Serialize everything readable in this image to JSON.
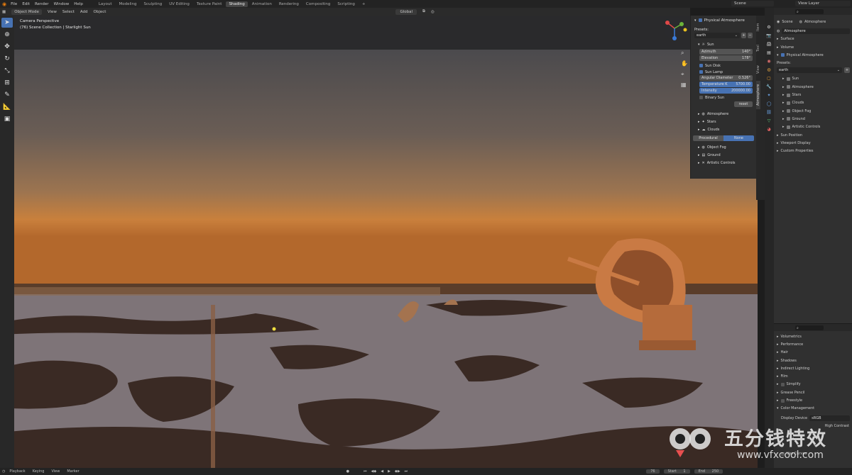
{
  "menu": [
    "File",
    "Edit",
    "Render",
    "Window",
    "Help"
  ],
  "workspaces": [
    "Layout",
    "Modeling",
    "Sculpting",
    "UV Editing",
    "Texture Paint",
    "Shading",
    "Animation",
    "Rendering",
    "Compositing",
    "Scripting",
    "+"
  ],
  "active_workspace_index": 5,
  "scene_field": "Scene",
  "view_layer_field": "View Layer",
  "viewport_header": {
    "mode": "Object Mode",
    "items": [
      "View",
      "Select",
      "Add",
      "Object"
    ],
    "transform": "Global"
  },
  "viewport_info": {
    "line1": "Camera Perspective",
    "line2": "(76) Scene Collection | Starlight Sun"
  },
  "npanel": {
    "addon_title": "Physical Atmosphere",
    "presets_label": "Presets:",
    "preset_value": "earth",
    "sun_header": "Sun",
    "azimuth_label": "Azimuth",
    "azimuth_value": "140°",
    "elevation_label": "Elevation",
    "elevation_value": "178°",
    "sun_disk": "Sun Disk",
    "sun_lamp": "Sun Lamp",
    "angular_label": "Angular Diameter",
    "angular_value": "0.526°",
    "temp_label": "Temperature K",
    "temp_value": "5700.00",
    "intensity_label": "Intensity",
    "intensity_value": "200000.00",
    "binary_sun": "Binary Sun",
    "reset": "reset",
    "atmosphere": "Atmosphere",
    "stars": "Stars",
    "clouds": "Clouds",
    "tab_procedural": "Procedural",
    "tab_none": "None",
    "object_fog": "Object Fog",
    "ground": "Ground",
    "artistic": "Artistic Controls"
  },
  "vertical_tabs": [
    "Item",
    "Tool",
    "View",
    "Atmosphere"
  ],
  "properties": {
    "breadcrumb_scene": "Scene",
    "breadcrumb_atm": "Atmosphere",
    "field": "Atmosphere",
    "surface": "Surface",
    "volume": "Volume",
    "phys": "Physical Atmosphere",
    "presets_label": "Presets:",
    "preset_value": "earth",
    "subs": [
      "Sun",
      "Atmosphere",
      "Stars",
      "Clouds",
      "Object Fog",
      "Ground",
      "Artistic Controls"
    ],
    "bottom": [
      "Sun Position",
      "Viewport Display",
      "Custom Properties"
    ]
  },
  "render_props": {
    "items": [
      "Volumetrics",
      "Performance",
      "Hair",
      "Shadows",
      "Indirect Lighting",
      "Film",
      "Simplify",
      "Grease Pencil",
      "Freestyle",
      "Color Management"
    ],
    "display_device_label": "Display Device",
    "display_device_value": "sRGB",
    "high_contrast": "High Contrast",
    "use_curves": "Use Curves"
  },
  "bottombar": {
    "items": [
      "Playback",
      "Keying",
      "View",
      "Marker"
    ],
    "frame": "76",
    "start_label": "Start",
    "start_value": "1",
    "end_label": "End",
    "end_value": "250"
  },
  "watermark": {
    "cn": "五分钱特效",
    "url": "www.vfxcool.com"
  },
  "colors": {
    "accent": "#4772b3",
    "sky_top": "#4b4a4d",
    "horizon": "#d07a2a",
    "snow": "#7e7478",
    "dish": "#c97a44"
  }
}
